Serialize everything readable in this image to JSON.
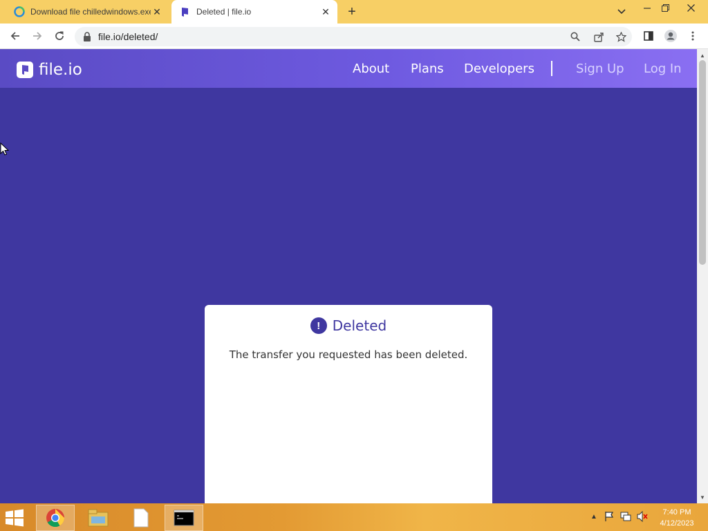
{
  "browser": {
    "tabs": [
      {
        "title": "Download file chilledwindows.exe",
        "active": false,
        "icon": "edge-loading-icon"
      },
      {
        "title": "Deleted | file.io",
        "active": true,
        "icon": "fileio-favicon"
      }
    ],
    "url": "file.io/deleted/"
  },
  "site": {
    "logo_text": "file.io",
    "nav": {
      "about": "About",
      "plans": "Plans",
      "developers": "Developers",
      "signup": "Sign Up",
      "login": "Log In"
    }
  },
  "card": {
    "title": "Deleted",
    "message": "The transfer you requested has been deleted."
  },
  "taskbar": {
    "apps": [
      "chrome-icon",
      "file-explorer-icon",
      "notepad-icon",
      "command-prompt-icon"
    ],
    "time": "7:40 PM",
    "date": "4/12/2023"
  },
  "colors": {
    "page_bg": "#3f37a0",
    "header_start": "#5a4bc4",
    "header_end": "#8a6ff2",
    "tabstrip": "#f7cf65"
  }
}
